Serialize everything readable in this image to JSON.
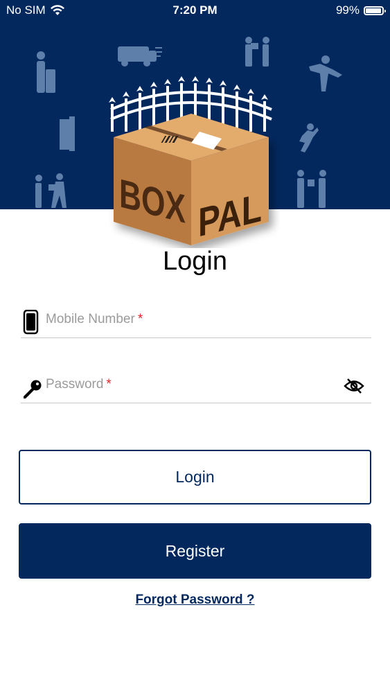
{
  "status_bar": {
    "carrier": "No SIM",
    "time": "7:20 PM",
    "battery": "99%",
    "battery_level": 0.99
  },
  "brand": {
    "logo_left": "BOX",
    "logo_right": "PAL",
    "header_color": "#03285e",
    "box_color": "#c98f55"
  },
  "login": {
    "title": "Login",
    "mobile_placeholder": "Mobile Number",
    "password_placeholder": "Password",
    "required_marker": "*",
    "login_button": "Login",
    "register_button": "Register",
    "forgot_password": "Forgot Password ?"
  },
  "icons": {
    "mobile": "phone-icon",
    "password": "key-icon",
    "toggle": "eye-off-icon"
  },
  "colors": {
    "primary": "#03285e",
    "required": "#e0262a",
    "placeholder": "#9b9b9b"
  }
}
